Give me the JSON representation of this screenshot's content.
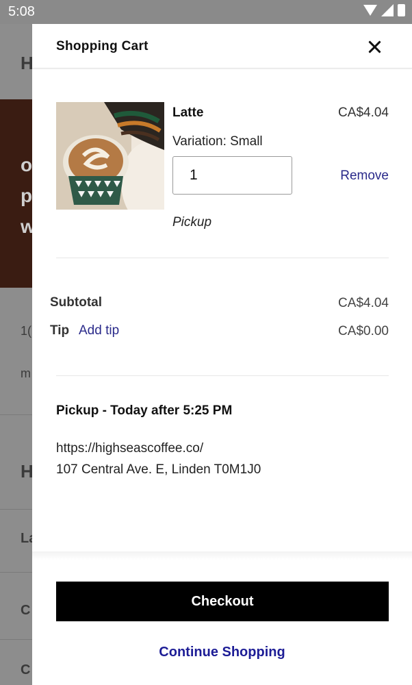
{
  "status_bar": {
    "time": "5:08"
  },
  "background_page": {
    "fragments": [
      "H",
      "o",
      "p",
      "w",
      "1(",
      "m",
      "H",
      "La",
      "C",
      "C"
    ]
  },
  "cart": {
    "title": "Shopping Cart",
    "item": {
      "name": "Latte",
      "price": "CA$4.04",
      "variation": "Variation: Small",
      "quantity": "1",
      "remove_label": "Remove",
      "fulfillment": "Pickup"
    },
    "summary": {
      "subtotal_label": "Subtotal",
      "subtotal_value": "CA$4.04",
      "tip_label": "Tip",
      "add_tip_label": "Add tip",
      "tip_value": "CA$0.00"
    },
    "pickup": {
      "title": "Pickup - Today after 5:25 PM",
      "url": "https://highseascoffee.co/",
      "address": "107 Central Ave. E, Linden T0M1J0"
    },
    "checkout_label": "Checkout",
    "continue_label": "Continue Shopping"
  },
  "icons": {
    "close": "close-icon",
    "wifi": "wifi-icon",
    "signal": "signal-icon",
    "battery": "battery-icon"
  }
}
